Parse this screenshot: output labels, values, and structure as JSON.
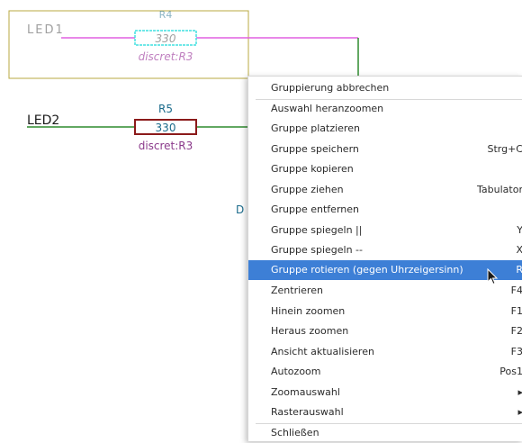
{
  "schematic": {
    "top_ref": "LED1",
    "top_value_label": "R4",
    "top_resistor_value": "330",
    "top_footprint": "discret:R3",
    "bottom_ref": "LED2",
    "bottom_value_label": "R5",
    "bottom_resistor_value": "330",
    "bottom_footprint": "discret:R3",
    "partial_label": "D",
    "colors": {
      "wire": "#2e8b2e",
      "selected_wire": "#e060e0",
      "resistor_body": "#8b1a1a",
      "selected_body": "#40e0e0",
      "footprint_text": "#8b3a8b",
      "value_text": "#1a6b8b",
      "selection_box": "#b8a840",
      "label_text": "#1a1a1a"
    }
  },
  "context_menu": {
    "items": [
      {
        "label": "Gruppierung abbrechen",
        "shortcut": ""
      },
      {
        "label": "Auswahl heranzoomen",
        "shortcut": ""
      },
      {
        "label": "Gruppe platzieren",
        "shortcut": ""
      },
      {
        "label": "Gruppe speichern",
        "shortcut": "Strg+C"
      },
      {
        "label": "Gruppe kopieren",
        "shortcut": ""
      },
      {
        "label": "Gruppe ziehen",
        "shortcut": "Tabulator"
      },
      {
        "label": "Gruppe entfernen",
        "shortcut": ""
      },
      {
        "label": "Gruppe spiegeln ||",
        "shortcut": "Y"
      },
      {
        "label": "Gruppe spiegeln --",
        "shortcut": "X"
      },
      {
        "label": "Gruppe rotieren (gegen Uhrzeigersinn)",
        "shortcut": "R",
        "highlighted": true
      },
      {
        "label": "Zentrieren",
        "shortcut": "F4"
      },
      {
        "label": "Hinein zoomen",
        "shortcut": "F1"
      },
      {
        "label": "Heraus zoomen",
        "shortcut": "F2"
      },
      {
        "label": "Ansicht aktualisieren",
        "shortcut": "F3"
      },
      {
        "label": "Autozoom",
        "shortcut": "Pos1"
      },
      {
        "label": "Zoomauswahl",
        "shortcut": "▸"
      },
      {
        "label": "Rasterauswahl",
        "shortcut": "▸"
      },
      {
        "label": "Schließen",
        "shortcut": ""
      }
    ],
    "highlight_color": "#3d7fd6"
  }
}
